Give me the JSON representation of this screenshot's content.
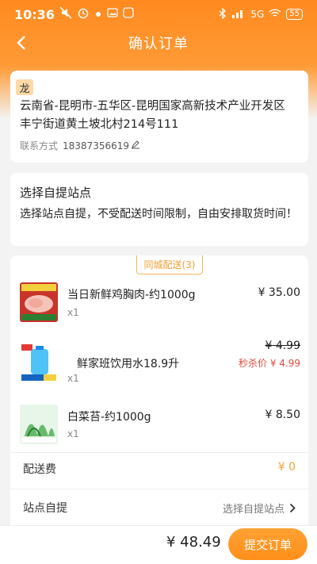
{
  "status_bar": {
    "time": "10:36",
    "battery": "55",
    "network": "5G"
  },
  "nav": {
    "title": "确认订单"
  },
  "address": {
    "badge": "龙",
    "line1": "云南省-昆明市-五华区-昆明国家高新技术产业开发区",
    "line2": "丰宁街道黄土坡北村214号111",
    "contact_label": "联系方式",
    "phone": "18387356619"
  },
  "pickup": {
    "title": "选择自提站点",
    "desc": "选择站点自提，不受配送时间限制，自由安排取货时间！"
  },
  "order": {
    "tab_label": "同城配送(3)",
    "items": [
      {
        "name": "当日新鲜鸡胸肉-约1000g",
        "qty": "x1",
        "price": "¥ 35.00",
        "thumb": "chicken-breast"
      },
      {
        "name": "鲜家班饮用水18.9升",
        "qty": "x1",
        "orig_price": "¥ 4.99",
        "sale_label": "秒杀价  ¥ 4.99",
        "thumb": "water-bottle"
      },
      {
        "name": "白菜苔-约1000g",
        "qty": "x1",
        "price": "¥ 8.50",
        "thumb": "vegetable"
      }
    ],
    "delivery_fee_label": "配送费",
    "delivery_fee_value": "¥ 0",
    "pickup_row_label": "站点自提",
    "pickup_row_link": "选择自提站点"
  },
  "footer": {
    "total": "¥ 48.49",
    "submit_label": "提交订单"
  },
  "colors": {
    "accent": "#ff8f1a",
    "sale": "#e24a3b",
    "tab": "#f0a030"
  }
}
